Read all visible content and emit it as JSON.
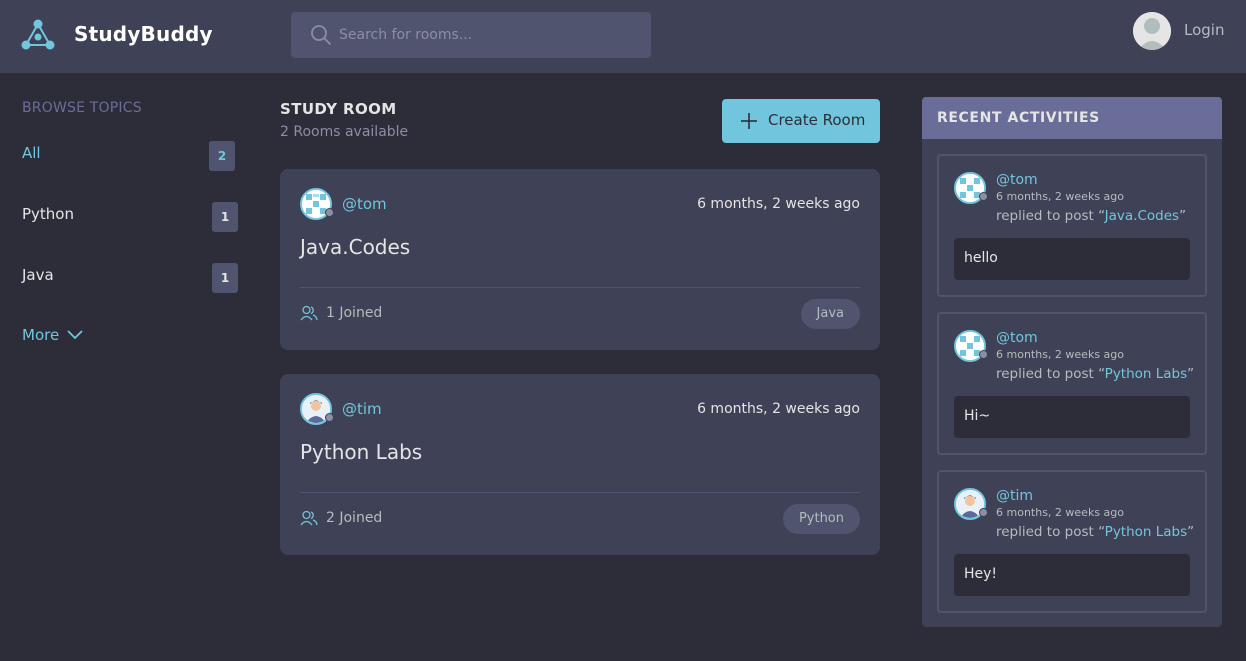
{
  "brand": {
    "name": "StudyBuddy"
  },
  "search": {
    "placeholder": "Search for rooms..."
  },
  "header": {
    "login_label": "Login"
  },
  "sidebar": {
    "title": "Browse Topics",
    "topics": [
      {
        "label": "All",
        "count": "2"
      },
      {
        "label": "Python",
        "count": "1"
      },
      {
        "label": "Java",
        "count": "1"
      }
    ],
    "more_label": "More"
  },
  "main": {
    "title": "STUDY ROOM",
    "subtitle": "2 Rooms available",
    "create_label": "Create Room",
    "rooms": [
      {
        "host": "@tom",
        "time": "6 months, 2 weeks ago",
        "name": "Java.Codes",
        "joined": "1 Joined",
        "topic": "Java"
      },
      {
        "host": "@tim",
        "time": "6 months, 2 weeks ago",
        "name": "Python Labs",
        "joined": "2 Joined",
        "topic": "Python"
      }
    ]
  },
  "recent": {
    "title": "RECENT ACTIVITIES",
    "items": [
      {
        "user": "@tom",
        "time": "6 months, 2 weeks ago",
        "prefix": "replied to post",
        "post": "Java.Codes",
        "message": "hello"
      },
      {
        "user": "@tom",
        "time": "6 months, 2 weeks ago",
        "prefix": "replied to post",
        "post": "Python Labs",
        "message": "Hi~"
      },
      {
        "user": "@tim",
        "time": "6 months, 2 weeks ago",
        "prefix": "replied to post",
        "post": "Python Labs",
        "message": "Hey!"
      }
    ]
  },
  "colors": {
    "background": "#2d2d39",
    "panel": "#3f4156",
    "accent": "#71c6dd",
    "header_accent": "#696d97"
  }
}
